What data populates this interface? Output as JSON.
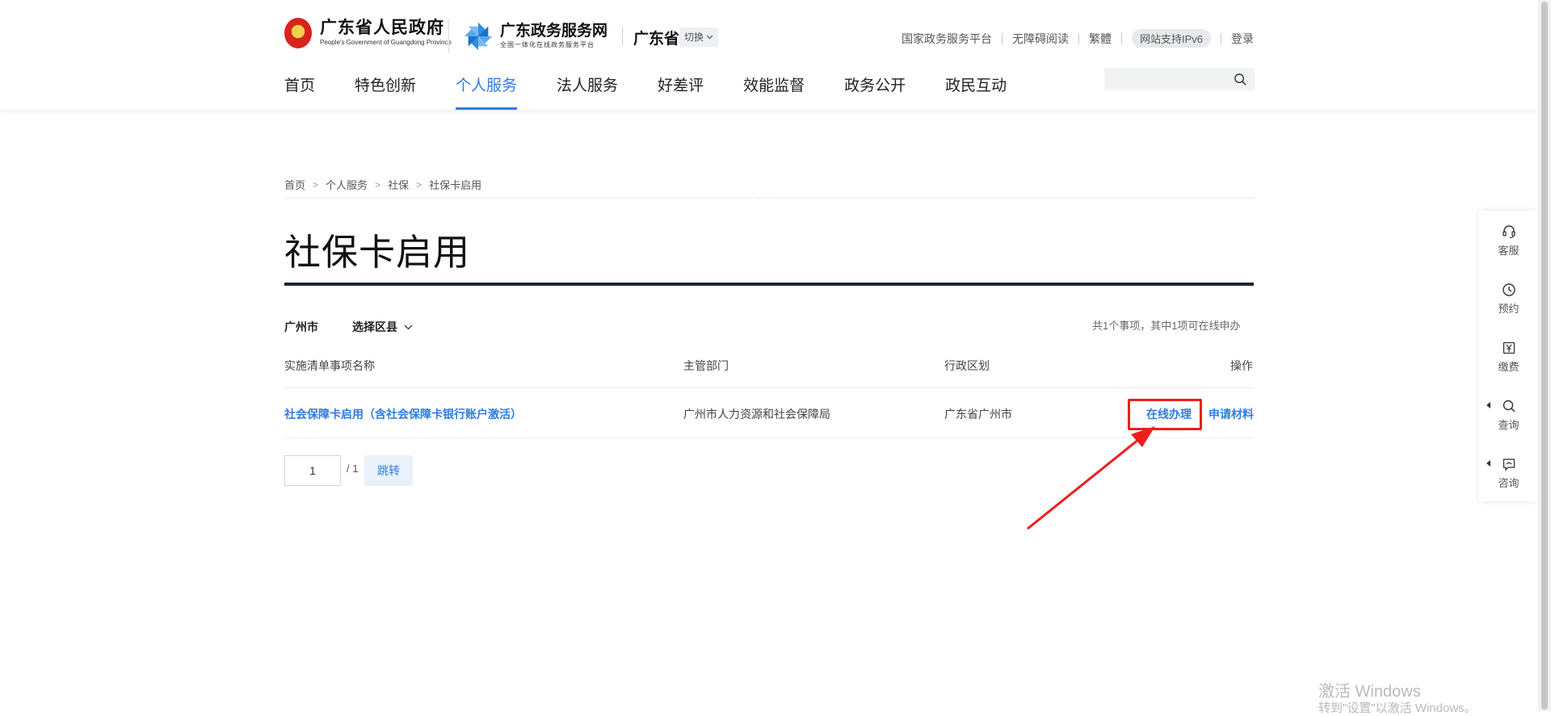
{
  "header": {
    "gov_name": "广东省人民政府",
    "gov_name_en": "People's Government of Guangdong Province",
    "service_name": "广东政务服务网",
    "service_sub": "全国一体化在线政务服务平台",
    "province": "广东省",
    "switch_label": "切换",
    "top_links": {
      "national_platform": "国家政务服务平台",
      "accessible": "无障碍阅读",
      "traditional": "繁體",
      "ipv6": "网站支持IPv6",
      "login": "登录"
    },
    "nav": [
      "首页",
      "特色创新",
      "个人服务",
      "法人服务",
      "好差评",
      "效能监督",
      "政务公开",
      "政民互动"
    ],
    "nav_active_index": 2,
    "search_placeholder": ""
  },
  "breadcrumb": [
    "首页",
    "个人服务",
    "社保",
    "社保卡启用"
  ],
  "breadcrumb_sep": ">",
  "page_title": "社保卡启用",
  "filter": {
    "city": "广州市",
    "district": "选择区县",
    "summary": "共1个事项，其中1项可在线申办"
  },
  "table": {
    "headers": [
      "实施清单事项名称",
      "主管部门",
      "行政区划",
      "操作"
    ],
    "rows": [
      {
        "name": "社会保障卡启用（含社会保障卡银行账户激活）",
        "department": "广州市人力资源和社会保障局",
        "region": "广东省广州市",
        "actions": [
          "在线办理",
          "申请材料"
        ]
      }
    ]
  },
  "pager": {
    "current": "1",
    "total": "/ 1",
    "go_label": "跳转"
  },
  "sidebar": [
    "客服",
    "预约",
    "缴费",
    "查询",
    "咨询"
  ],
  "watermark": {
    "line1": "激活 Windows",
    "line2": "转到\"设置\"以激活 Windows。"
  },
  "colors": {
    "accent": "#2f7de1",
    "highlight": "#ee1e1e",
    "title_rule": "#1c2433"
  }
}
